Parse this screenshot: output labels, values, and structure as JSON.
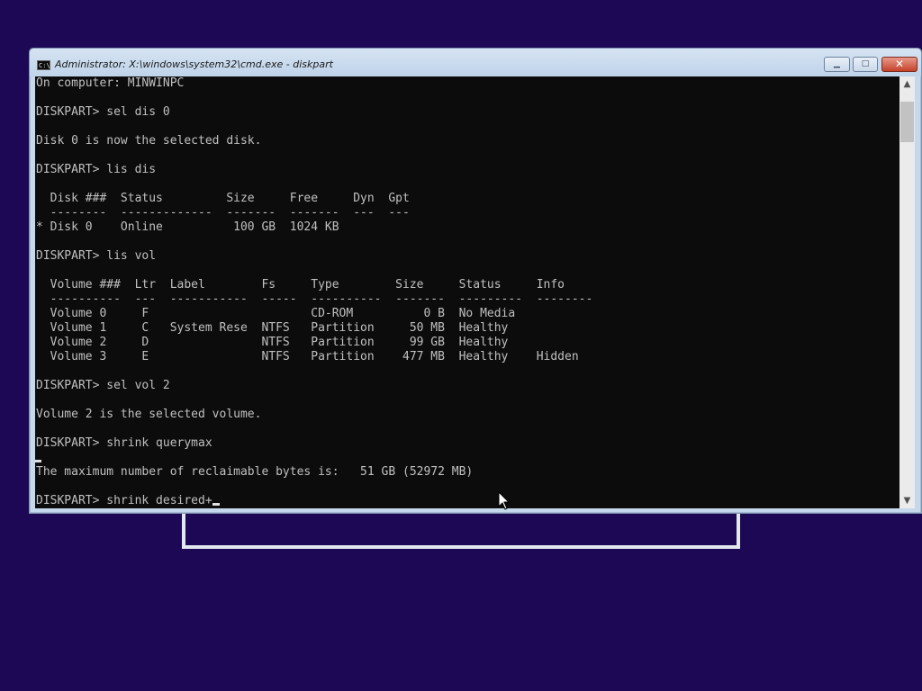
{
  "window": {
    "title": "Administrator: X:\\windows\\system32\\cmd.exe - diskpart",
    "icon": "C:\\",
    "minimize_icon": "minimize-icon",
    "maximize_icon": "maximize-icon",
    "close_icon": "close-icon"
  },
  "console": {
    "lines": [
      "On computer: MINWINPC",
      "",
      "DISKPART> sel dis 0",
      "",
      "Disk 0 is now the selected disk.",
      "",
      "DISKPART> lis dis",
      "",
      "  Disk ###  Status         Size     Free     Dyn  Gpt",
      "  --------  -------------  -------  -------  ---  ---",
      "* Disk 0    Online          100 GB  1024 KB",
      "",
      "DISKPART> lis vol",
      "",
      "  Volume ###  Ltr  Label        Fs     Type        Size     Status     Info",
      "  ----------  ---  -----------  -----  ----------  -------  ---------  --------",
      "  Volume 0     F                       CD-ROM          0 B  No Media",
      "  Volume 1     C   System Rese  NTFS   Partition     50 MB  Healthy",
      "  Volume 2     D                NTFS   Partition     99 GB  Healthy",
      "  Volume 3     E                NTFS   Partition    477 MB  Healthy    Hidden",
      "",
      "DISKPART> sel vol 2",
      "",
      "Volume 2 is the selected volume.",
      "",
      "DISKPART> shrink querymax",
      "",
      "The maximum number of reclaimable bytes is:   51 GB (52972 MB)",
      "",
      "DISKPART> shrink desired+"
    ]
  },
  "colors": {
    "desktop_background": "#1c0854",
    "console_background": "#0c0c0c",
    "console_text": "#c0c0c0",
    "titlebar": "#c6d9ec",
    "close_button": "#c5412b"
  }
}
